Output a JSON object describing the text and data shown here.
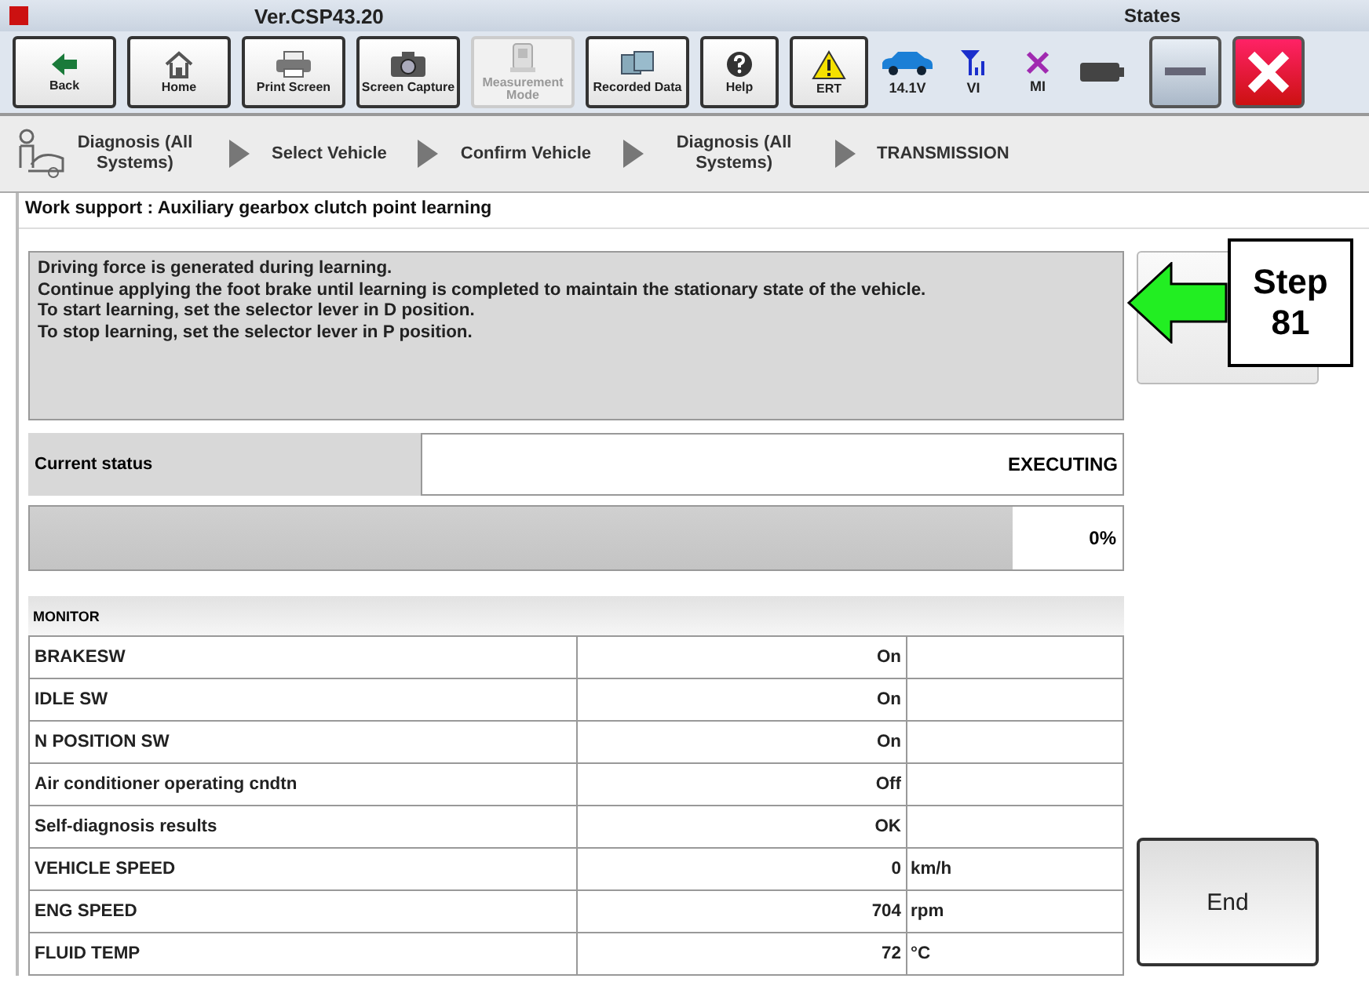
{
  "app": {
    "version": "Ver.CSP43.20",
    "states_label": "States"
  },
  "toolbar": [
    {
      "kind": "back",
      "label": "Back",
      "disabled": false
    },
    {
      "kind": "home",
      "label": "Home",
      "disabled": false
    },
    {
      "kind": "print",
      "label": "Print Screen",
      "disabled": false
    },
    {
      "kind": "camera",
      "label": "Screen Capture",
      "disabled": false
    },
    {
      "kind": "measure",
      "label": "Measurement Mode",
      "disabled": true
    },
    {
      "kind": "recorded",
      "label": "Recorded Data",
      "disabled": false
    },
    {
      "kind": "help",
      "label": "Help",
      "disabled": false
    },
    {
      "kind": "ert",
      "label": "ERT",
      "disabled": false
    }
  ],
  "status_icons": [
    {
      "kind": "car",
      "label": "14.1V"
    },
    {
      "kind": "vi",
      "label": "VI"
    },
    {
      "kind": "mi",
      "label": "MI"
    },
    {
      "kind": "battery"
    }
  ],
  "window_buttons": [
    {
      "kind": "minimize"
    },
    {
      "kind": "close"
    }
  ],
  "breadcrumbs": [
    "Diagnosis (All Systems)",
    "Select Vehicle",
    "Confirm Vehicle",
    "Diagnosis (All Systems)",
    "TRANSMISSION"
  ],
  "page_title": "Work support : Auxiliary gearbox clutch point learning",
  "message": [
    "Driving force is generated during learning.",
    "Continue applying the foot brake until learning is completed to maintain the stationary state of the vehicle.",
    "To start learning, set the selector lever in D position.",
    "To stop learning, set the selector lever in P position."
  ],
  "current_status": {
    "label": "Current status",
    "value": "EXECUTING"
  },
  "progress": {
    "level": 0.9,
    "reading": "0%"
  },
  "monitor": {
    "title": "MONITOR",
    "rows": [
      {
        "name": "BRAKESW",
        "value": "On"
      },
      {
        "name": "IDLE SW",
        "value": "On"
      },
      {
        "name": "N POSITION SW",
        "value": "On"
      },
      {
        "name": "Air conditioner operating cndtn",
        "value": "Off"
      },
      {
        "name": "Self-diagnosis results",
        "value": "OK"
      },
      {
        "name": "VEHICLE SPEED",
        "value": "0",
        "unit": "km/h"
      },
      {
        "name": "ENG SPEED",
        "value": "704",
        "unit": "rpm"
      },
      {
        "name": "FLUID TEMP",
        "value": "72",
        "unit": "°C"
      }
    ]
  },
  "end_button": "End",
  "callout": {
    "text": "Step 81"
  }
}
